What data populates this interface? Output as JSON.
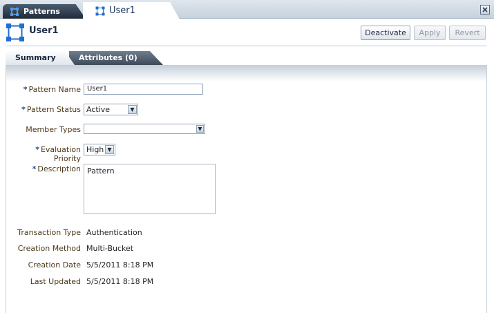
{
  "tabs": {
    "patterns_label": "Patterns",
    "user_label": "User1"
  },
  "header": {
    "title": "User1",
    "deactivate_label": "Deactivate",
    "apply_label": "Apply",
    "revert_label": "Revert"
  },
  "subtabs": {
    "summary_label": "Summary",
    "attributes_label": "Attributes (0)"
  },
  "form": {
    "pattern_name_label": "Pattern Name",
    "pattern_name_value": "User1",
    "pattern_status_label": "Pattern Status",
    "pattern_status_value": "Active",
    "member_types_label": "Member Types",
    "member_types_value": "",
    "evaluation_priority_label": "Evaluation Priority",
    "evaluation_priority_value": "High",
    "description_label": "Description",
    "description_value": "Pattern",
    "required_marker": "*"
  },
  "details": {
    "transaction_type_label": "Transaction Type",
    "transaction_type_value": "Authentication",
    "creation_method_label": "Creation Method",
    "creation_method_value": "Multi-Bucket",
    "creation_date_label": "Creation Date",
    "creation_date_value": "5/5/2011 8:18 PM",
    "last_updated_label": "Last Updated",
    "last_updated_value": "5/5/2011 8:18 PM"
  },
  "colors": {
    "accent": "#1f6fd1",
    "tab_dark": "#2a3748",
    "label_text": "#4a3818"
  },
  "icons": {
    "pattern_icon": "pattern-icon",
    "close_icon": "close-icon",
    "dropdown_icon": "chevron-down-icon"
  }
}
